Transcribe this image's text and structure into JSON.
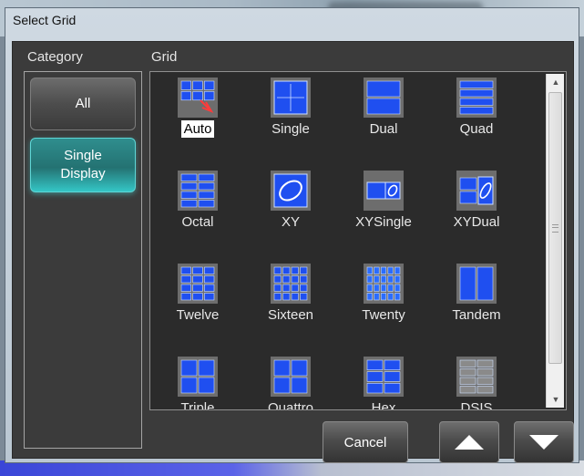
{
  "window": {
    "title": "Select Grid"
  },
  "headers": {
    "category": "Category",
    "grid": "Grid"
  },
  "categories": [
    {
      "label": "All",
      "selected": false
    },
    {
      "label": "Single\nDisplay",
      "selected": true
    }
  ],
  "grid_items": [
    {
      "label": "Auto",
      "icon": "auto-grid-icon",
      "selected": true
    },
    {
      "label": "Single",
      "icon": "single-grid-icon",
      "selected": false
    },
    {
      "label": "Dual",
      "icon": "dual-grid-icon",
      "selected": false
    },
    {
      "label": "Quad",
      "icon": "quad-grid-icon",
      "selected": false
    },
    {
      "label": "Octal",
      "icon": "octal-grid-icon",
      "selected": false
    },
    {
      "label": "XY",
      "icon": "xy-grid-icon",
      "selected": false
    },
    {
      "label": "XYSingle",
      "icon": "xysingle-grid-icon",
      "selected": false
    },
    {
      "label": "XYDual",
      "icon": "xydual-grid-icon",
      "selected": false
    },
    {
      "label": "Twelve",
      "icon": "twelve-grid-icon",
      "selected": false
    },
    {
      "label": "Sixteen",
      "icon": "sixteen-grid-icon",
      "selected": false
    },
    {
      "label": "Twenty",
      "icon": "twenty-grid-icon",
      "selected": false
    },
    {
      "label": "Tandem",
      "icon": "tandem-grid-icon",
      "selected": false
    },
    {
      "label": "Triple",
      "icon": "triple-grid-icon",
      "selected": false
    },
    {
      "label": "Quattro",
      "icon": "quattro-grid-icon",
      "selected": false
    },
    {
      "label": "Hex",
      "icon": "hex-grid-icon",
      "selected": false
    },
    {
      "label": "DSIS",
      "icon": "dsis-grid-icon",
      "selected": false
    }
  ],
  "buttons": {
    "cancel": "Cancel"
  },
  "colors": {
    "panel": "#3b3b3b",
    "grid_bg": "#2b2b2b",
    "icon_blue": "#1f4ff0",
    "accent_teal": "#2a8a8a"
  }
}
